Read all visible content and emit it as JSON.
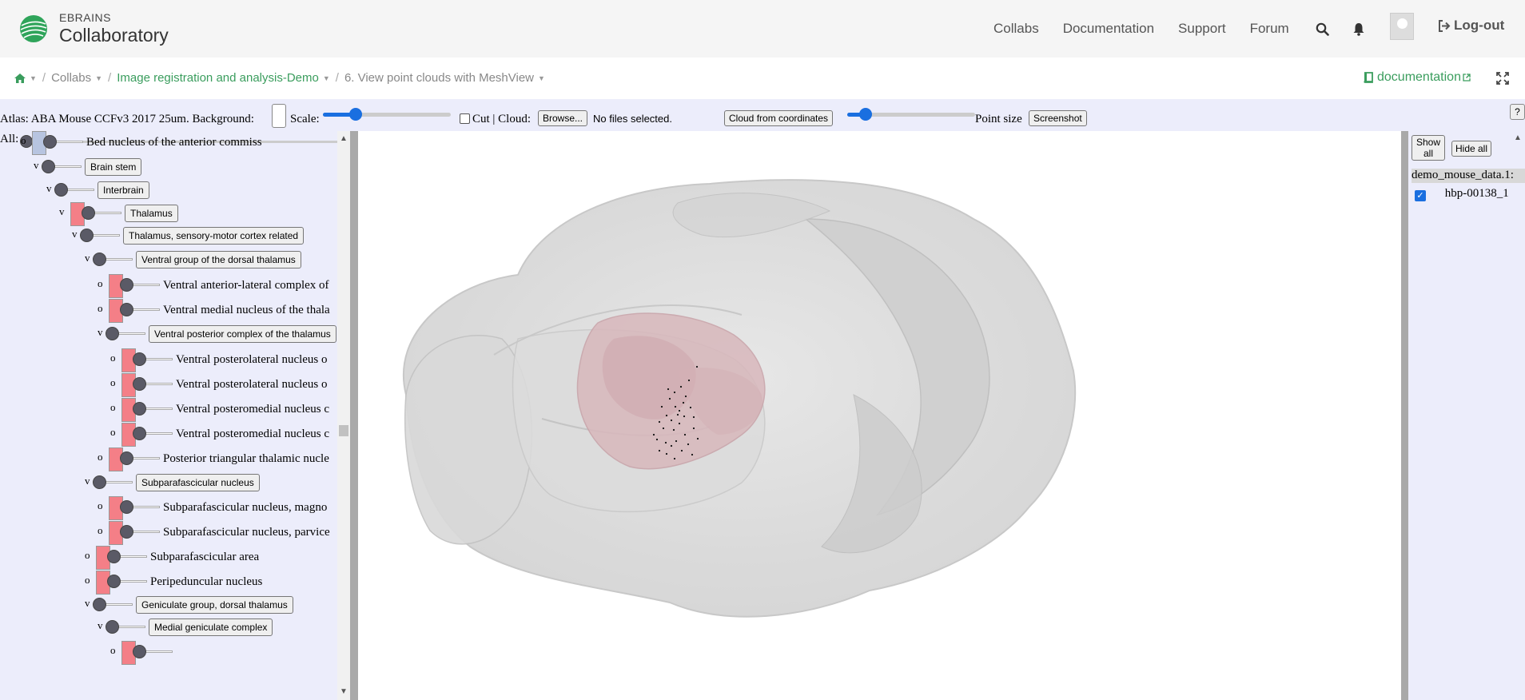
{
  "header": {
    "brand_small": "EBRAINS",
    "brand_big": "Collaboratory",
    "nav": [
      "Collabs",
      "Documentation",
      "Support",
      "Forum"
    ],
    "logout_label": "Log-out"
  },
  "breadcrumb": {
    "collabs": "Collabs",
    "collab": "Image registration and analysis-Demo",
    "page": "6. View point clouds with MeshView",
    "doc_link": "documentation"
  },
  "toolbar": {
    "atlas_label": "Atlas: ABA Mouse CCFv3 2017 25um. Background:",
    "scale_label": "Scale:",
    "cut_label": "Cut | Cloud:",
    "browse_label": "Browse...",
    "no_files": "No files selected.",
    "cloud_coords_label": "Cloud from coordinates",
    "point_size_label": "Point size",
    "screenshot_label": "Screenshot",
    "help_label": "?",
    "all_label": "All:"
  },
  "tree": [
    {
      "mark": "o",
      "label": "Bed nucleus of the anterior commiss",
      "button": false,
      "swatch": "#b7c4e0",
      "indent": 0
    },
    {
      "mark": "v",
      "label": "Brain stem",
      "button": true,
      "swatch": null,
      "indent": 1
    },
    {
      "mark": "v",
      "label": "Interbrain",
      "button": true,
      "swatch": null,
      "indent": 2
    },
    {
      "mark": "v",
      "label": "Thalamus",
      "button": true,
      "swatch": "#f47f87",
      "indent": 3
    },
    {
      "mark": "v",
      "label": "Thalamus, sensory-motor cortex related",
      "button": true,
      "swatch": null,
      "indent": 4
    },
    {
      "mark": "v",
      "label": "Ventral group of the dorsal thalamus",
      "button": true,
      "swatch": null,
      "indent": 5
    },
    {
      "mark": "o",
      "label": "Ventral anterior-lateral complex of",
      "button": false,
      "swatch": "#f47f87",
      "indent": 6
    },
    {
      "mark": "o",
      "label": "Ventral medial nucleus of the thala",
      "button": false,
      "swatch": "#f47f87",
      "indent": 6
    },
    {
      "mark": "v",
      "label": "Ventral posterior complex of the thalamus",
      "button": true,
      "swatch": null,
      "indent": 6
    },
    {
      "mark": "o",
      "label": "Ventral posterolateral nucleus o",
      "button": false,
      "swatch": "#f47f87",
      "indent": 7
    },
    {
      "mark": "o",
      "label": "Ventral posterolateral nucleus o",
      "button": false,
      "swatch": "#f47f87",
      "indent": 7
    },
    {
      "mark": "o",
      "label": "Ventral posteromedial nucleus c",
      "button": false,
      "swatch": "#f47f87",
      "indent": 7
    },
    {
      "mark": "o",
      "label": "Ventral posteromedial nucleus c",
      "button": false,
      "swatch": "#f47f87",
      "indent": 7
    },
    {
      "mark": "o",
      "label": "Posterior triangular thalamic nucle",
      "button": false,
      "swatch": "#f47f87",
      "indent": 6
    },
    {
      "mark": "v",
      "label": "Subparafascicular nucleus",
      "button": true,
      "swatch": null,
      "indent": 5
    },
    {
      "mark": "o",
      "label": "Subparafascicular nucleus, magno",
      "button": false,
      "swatch": "#f47f87",
      "indent": 6
    },
    {
      "mark": "o",
      "label": "Subparafascicular nucleus, parvice",
      "button": false,
      "swatch": "#f47f87",
      "indent": 6
    },
    {
      "mark": "o",
      "label": "Subparafascicular area",
      "button": false,
      "swatch": "#f47f87",
      "indent": 5
    },
    {
      "mark": "o",
      "label": "Peripeduncular nucleus",
      "button": false,
      "swatch": "#f47f87",
      "indent": 5
    },
    {
      "mark": "v",
      "label": "Geniculate group, dorsal thalamus",
      "button": true,
      "swatch": null,
      "indent": 5
    },
    {
      "mark": "v",
      "label": "Medial geniculate complex",
      "button": true,
      "swatch": null,
      "indent": 6
    },
    {
      "mark": "o",
      "label": "",
      "button": false,
      "swatch": "#f47f87",
      "indent": 7
    }
  ],
  "right_panel": {
    "show_all": "Show all",
    "hide_all": "Hide all",
    "file_header": "demo_mouse_data.1:",
    "file_entry": "hbp-00138_1"
  },
  "colors": {
    "accent_green": "#3a9d5d",
    "panel_bg": "#ecedfb",
    "region_red": "#f47f87",
    "slider_blue": "#1a6fe0"
  }
}
